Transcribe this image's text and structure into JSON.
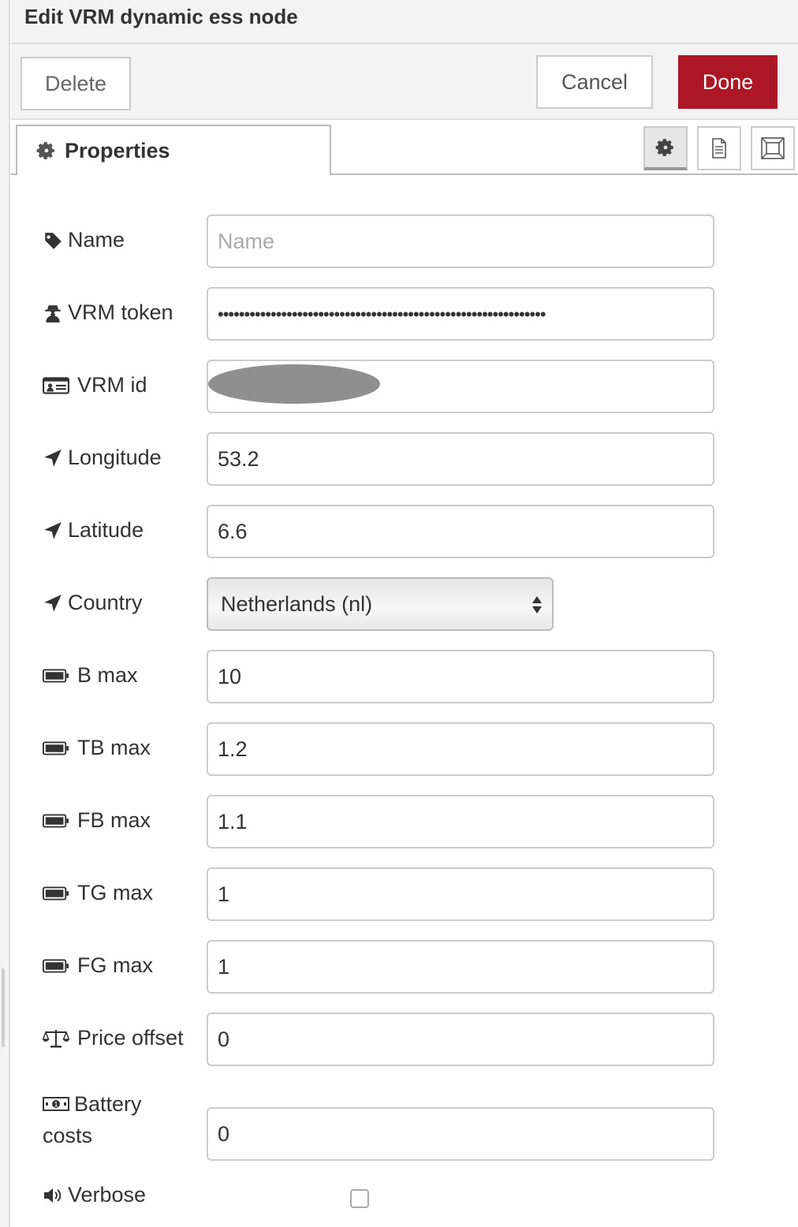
{
  "dialog": {
    "title": "Edit VRM dynamic ess node"
  },
  "buttons": {
    "delete": "Delete",
    "cancel": "Cancel",
    "done": "Done"
  },
  "tabs": {
    "properties_label": "Properties",
    "properties_icon": "gear-icon",
    "tray_icons": [
      "gear-icon",
      "document-icon",
      "frame-icon"
    ]
  },
  "fields": {
    "name": {
      "label": "Name",
      "icon": "tag-icon",
      "value": "",
      "placeholder": "Name"
    },
    "vrm_token": {
      "label": "VRM token",
      "icon": "user-secret-icon",
      "value": "••••••••••••••••••••••••••••••••••••••••••••••••••••••••••••••"
    },
    "vrm_id": {
      "label": "VRM id",
      "icon": "id-card-icon",
      "value": ""
    },
    "longitude": {
      "label": "Longitude",
      "icon": "location-arrow-icon",
      "value": "53.2"
    },
    "latitude": {
      "label": "Latitude",
      "icon": "location-arrow-icon",
      "value": "6.6"
    },
    "country": {
      "label": "Country",
      "icon": "location-arrow-icon",
      "value": "Netherlands (nl)"
    },
    "b_max": {
      "label": "B max",
      "icon": "battery-icon",
      "value": "10"
    },
    "tb_max": {
      "label": "TB max",
      "icon": "battery-icon",
      "value": "1.2"
    },
    "fb_max": {
      "label": "FB max",
      "icon": "battery-icon",
      "value": "1.1"
    },
    "tg_max": {
      "label": "TG max",
      "icon": "battery-icon",
      "value": "1"
    },
    "fg_max": {
      "label": "FG max",
      "icon": "battery-icon",
      "value": "1"
    },
    "price_offset": {
      "label": "Price offset",
      "icon": "balance-scale-icon",
      "value": "0"
    },
    "battery_costs": {
      "label_line1": "Battery",
      "label_line2": "costs",
      "icon": "money-icon",
      "value": "0"
    },
    "verbose": {
      "label": "Verbose",
      "icon": "volume-icon",
      "checked": false
    }
  },
  "colors": {
    "done_button": "#ad1625",
    "panel_background": "#f3f3f3"
  }
}
